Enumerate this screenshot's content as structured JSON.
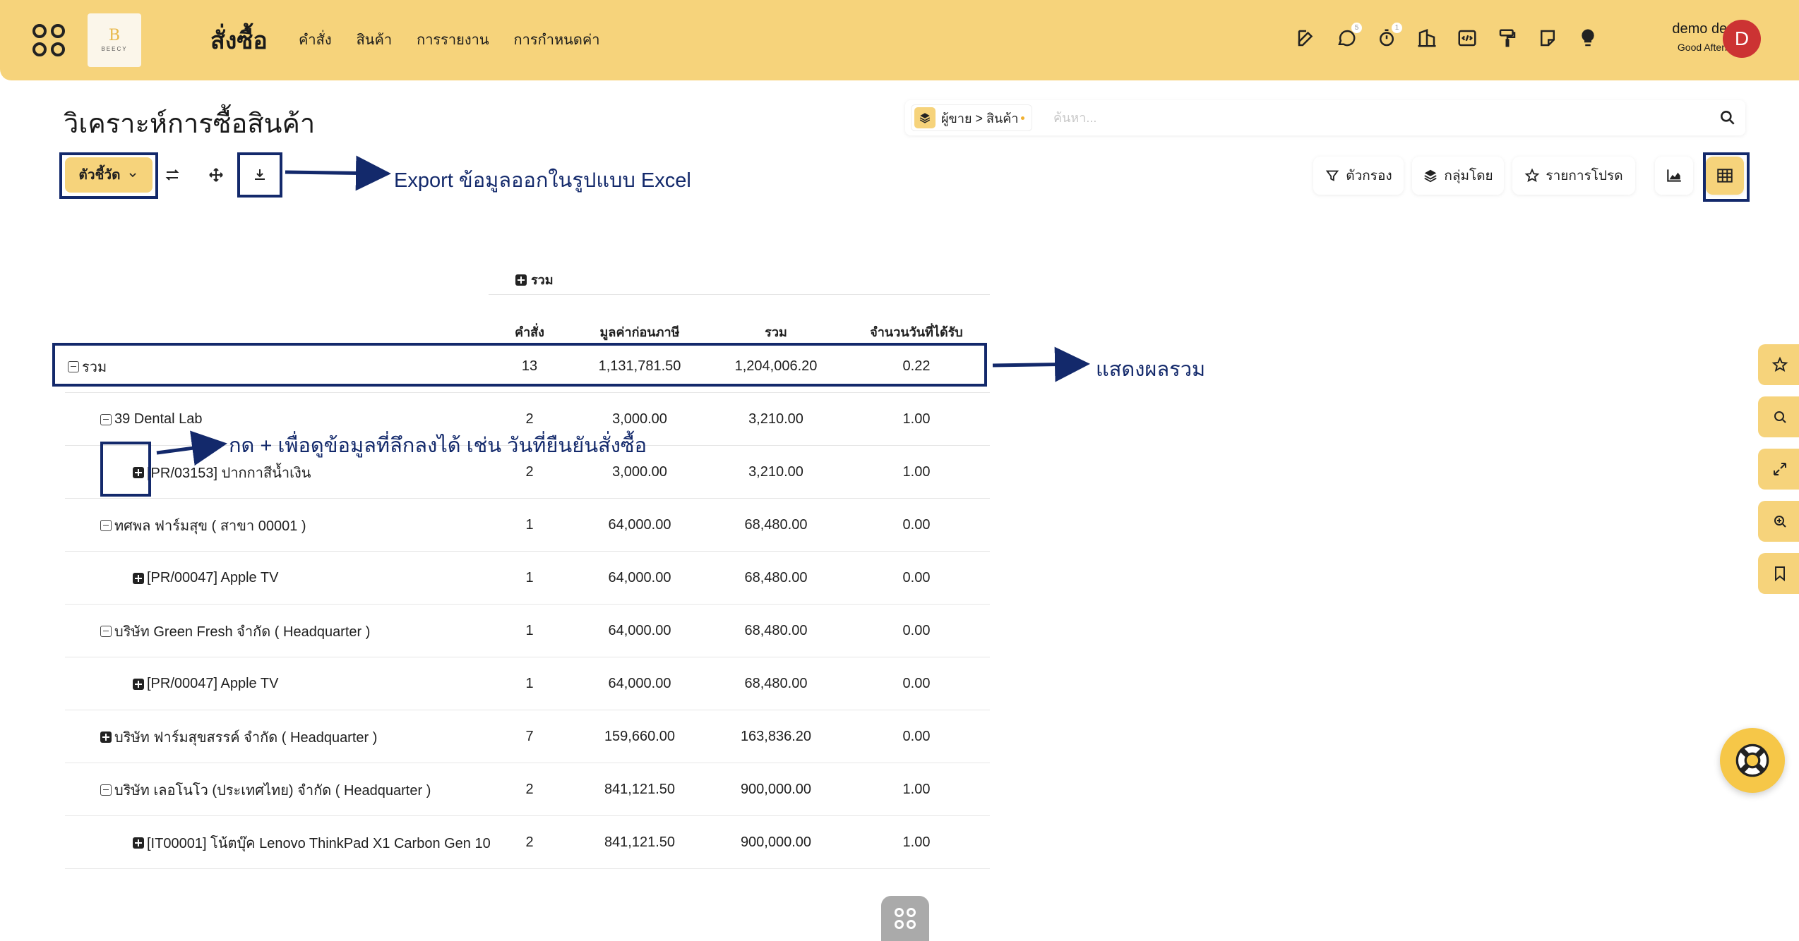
{
  "topbar": {
    "app_title": "สั่งซื้อ",
    "logo_text": "BEECY",
    "nav": [
      "คำสั่ง",
      "สินค้า",
      "การรายงาน",
      "การกำหนดค่า"
    ],
    "icons": [
      {
        "name": "edit-icon",
        "badge": ""
      },
      {
        "name": "chat-icon",
        "badge": "5"
      },
      {
        "name": "timer-icon",
        "badge": "1"
      },
      {
        "name": "building-icon",
        "badge": ""
      },
      {
        "name": "code-icon",
        "badge": ""
      },
      {
        "name": "paint-roller-icon",
        "badge": ""
      },
      {
        "name": "note-icon",
        "badge": ""
      },
      {
        "name": "lightbulb-icon",
        "badge": ""
      }
    ],
    "user_name": "demo demo",
    "greeting": "Good Afternoon",
    "avatar_letter": "D"
  },
  "page": {
    "title": "วิเคราะห์การซื้อสินค้า"
  },
  "search": {
    "facet_label": "ผู้ขาย > สินค้า",
    "placeholder": "ค้นหา..."
  },
  "toolbar": {
    "measures_label": "ตัวชี้วัด",
    "filter_label": "ตัวกรอง",
    "groupby_label": "กลุ่มโดย",
    "favorites_label": "รายการโปรด"
  },
  "annotations": {
    "export": "Export ข้อมูลออกในรูปแบบ Excel",
    "total": "แสดงผลรวม",
    "expand": "กด + เพื่อดูข้อมูลที่ลึกลงได้ เช่น วันที่ยืนยันสั่งซื้อ"
  },
  "pivot": {
    "group_header": "รวม",
    "columns": [
      "คำสั่ง",
      "มูลค่าก่อนภาษี",
      "รวม",
      "จำนวนวันที่ได้รับ"
    ],
    "rows": [
      {
        "label": "รวม",
        "toggle": "minus",
        "level": 0,
        "values": [
          "13",
          "1,131,781.50",
          "1,204,006.20",
          "0.22"
        ]
      },
      {
        "label": "39 Dental Lab",
        "toggle": "minus",
        "level": 1,
        "values": [
          "2",
          "3,000.00",
          "3,210.00",
          "1.00"
        ]
      },
      {
        "label": "[PR/03153] ปากกาสีน้ำเงิน",
        "toggle": "plus",
        "level": 2,
        "values": [
          "2",
          "3,000.00",
          "3,210.00",
          "1.00"
        ]
      },
      {
        "label": "ทศพล ฟาร์มสุข ( สาขา 00001 )",
        "toggle": "minus",
        "level": 1,
        "values": [
          "1",
          "64,000.00",
          "68,480.00",
          "0.00"
        ]
      },
      {
        "label": "[PR/00047] Apple TV",
        "toggle": "plus",
        "level": 2,
        "values": [
          "1",
          "64,000.00",
          "68,480.00",
          "0.00"
        ]
      },
      {
        "label": "บริษัท Green Fresh จำกัด ( Headquarter )",
        "toggle": "minus",
        "level": 1,
        "values": [
          "1",
          "64,000.00",
          "68,480.00",
          "0.00"
        ]
      },
      {
        "label": "[PR/00047] Apple TV",
        "toggle": "plus",
        "level": 2,
        "values": [
          "1",
          "64,000.00",
          "68,480.00",
          "0.00"
        ]
      },
      {
        "label": "บริษัท ฟาร์มสุขสรรค์ จำกัด ( Headquarter )",
        "toggle": "plus",
        "level": 1,
        "values": [
          "7",
          "159,660.00",
          "163,836.20",
          "0.00"
        ]
      },
      {
        "label": "บริษัท เลอโนโว (ประเทศไทย) จำกัด ( Headquarter )",
        "toggle": "minus",
        "level": 1,
        "values": [
          "2",
          "841,121.50",
          "900,000.00",
          "1.00"
        ]
      },
      {
        "label": "[IT00001] โน้ตบุ๊ค Lenovo ThinkPad X1 Carbon Gen 10",
        "toggle": "plus",
        "level": 2,
        "values": [
          "2",
          "841,121.50",
          "900,000.00",
          "1.00"
        ]
      }
    ]
  },
  "colors": {
    "brand": "#f6d37b",
    "annotation": "#13296b",
    "avatar": "#cc3333"
  }
}
